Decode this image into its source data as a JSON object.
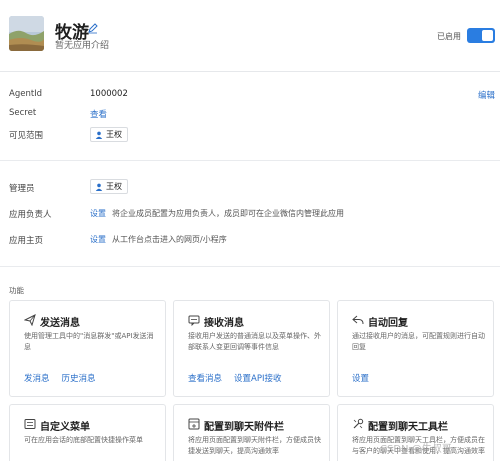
{
  "header": {
    "app_name": "牧游",
    "app_desc": "暂无应用介绍",
    "status_text": "已启用",
    "enabled": true
  },
  "info": {
    "edit_label": "编辑",
    "agentid_label": "AgentId",
    "agentid_value": "1000002",
    "secret_label": "Secret",
    "secret_action": "查看",
    "visible_label": "可见范围",
    "visible_user": "王权"
  },
  "admin": {
    "manager_label": "管理员",
    "manager_user": "王权",
    "owner_label": "应用负责人",
    "owner_action": "设置",
    "owner_hint": "将企业成员配置为应用负责人，成员即可在企业微信内管理此应用",
    "homepage_label": "应用主页",
    "homepage_action": "设置",
    "homepage_hint": "从工作台点击进入的网页/小程序"
  },
  "features": {
    "section_title": "功能",
    "cards": [
      {
        "title": "发送消息",
        "icon": "paper-plane-icon",
        "desc": "使用管理工具中的\"消息群发\"或API发送消息",
        "actions": [
          "发消息",
          "历史消息"
        ]
      },
      {
        "title": "接收消息",
        "icon": "message-box-icon",
        "desc": "接收用户发送的普通消息以及菜单操作、外部联系人变更回调等事件信息",
        "actions": [
          "查看消息",
          "设置API接收"
        ]
      },
      {
        "title": "自动回复",
        "icon": "reply-arrow-icon",
        "desc": "通过接收用户的消息，可配置规则进行自动回复",
        "actions": [
          "设置"
        ]
      },
      {
        "title": "自定义菜单",
        "icon": "menu-list-icon",
        "desc": "可在应用会话的底部配置快捷操作菜单",
        "actions": []
      },
      {
        "title": "配置到聊天附件栏",
        "icon": "attachment-bar-icon",
        "desc": "将应用页面配置到聊天附件栏，方便成员快捷发送到聊天，提高沟通效率",
        "actions": []
      },
      {
        "title": "配置到聊天工具栏",
        "icon": "tool-bar-icon",
        "desc": "将应用页面配置到聊天工具栏，方便成员在与客户的聊天中查看和使用，提高沟通效率",
        "actions": []
      }
    ]
  },
  "watermark": "CSDN @牛叔哥"
}
